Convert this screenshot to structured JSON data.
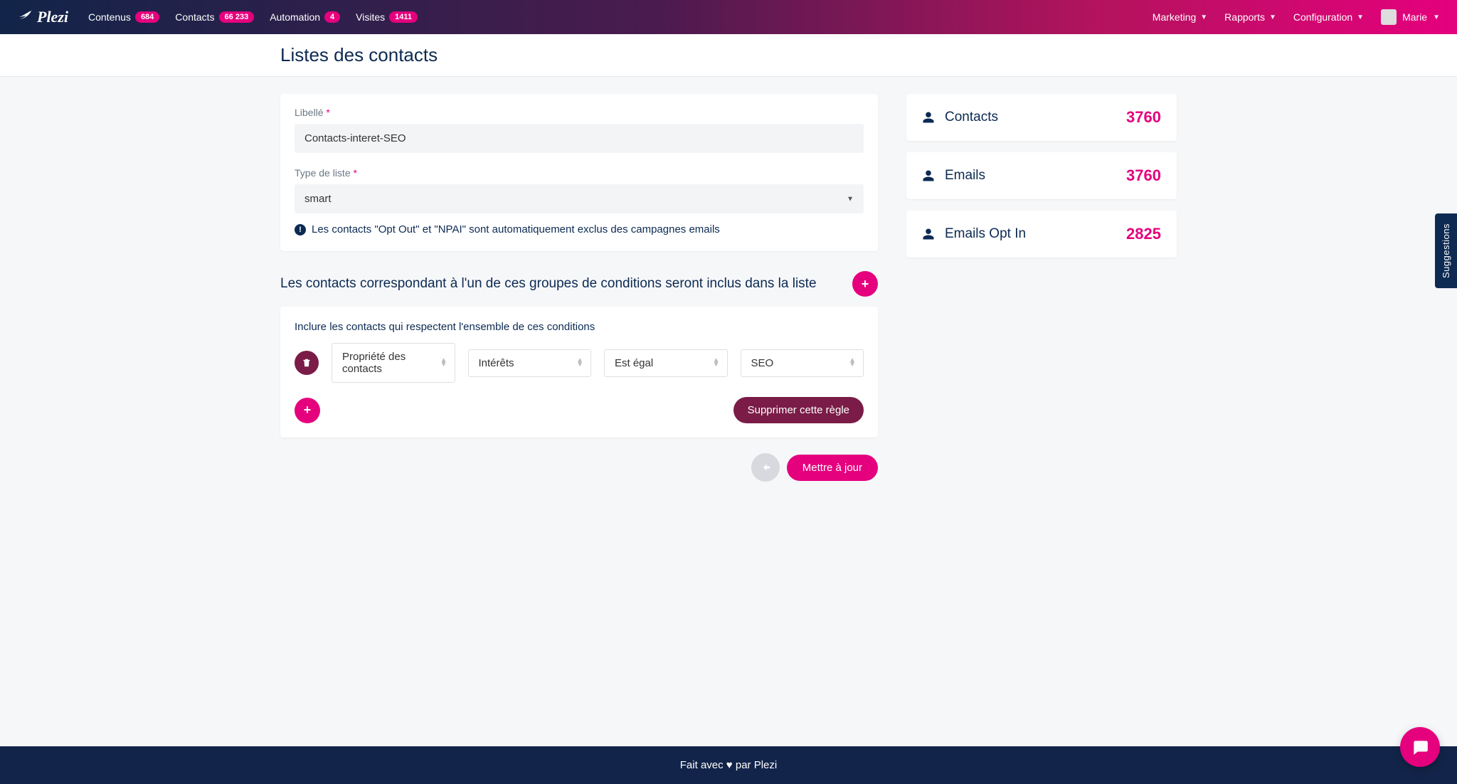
{
  "brand": "Plezi",
  "nav": {
    "left": [
      {
        "label": "Contenus",
        "badge": "684"
      },
      {
        "label": "Contacts",
        "badge": "66 233"
      },
      {
        "label": "Automation",
        "badge": "4"
      },
      {
        "label": "Visites",
        "badge": "1411"
      }
    ],
    "right": [
      {
        "label": "Marketing"
      },
      {
        "label": "Rapports"
      },
      {
        "label": "Configuration"
      }
    ],
    "user": "Marie"
  },
  "page": {
    "title": "Listes des contacts"
  },
  "form": {
    "libelle_label": "Libellé",
    "libelle_value": "Contacts-interet-SEO",
    "type_label": "Type de liste",
    "type_value": "smart",
    "info_text": "Les contacts \"Opt Out\" et \"NPAI\" sont automatiquement exclus des campagnes emails"
  },
  "conditions": {
    "heading": "Les contacts correspondant à l'un de ces groupes de conditions seront inclus dans la liste",
    "rule_intro": "Inclure les contacts qui respectent l'ensemble de ces conditions",
    "fields": {
      "property": "Propriété des contacts",
      "attribute": "Intérêts",
      "operator": "Est égal",
      "value": "SEO"
    },
    "delete_rule": "Supprimer cette règle"
  },
  "stats": [
    {
      "label": "Contacts",
      "value": "3760"
    },
    {
      "label": "Emails",
      "value": "3760"
    },
    {
      "label": "Emails Opt In",
      "value": "2825"
    }
  ],
  "actions": {
    "update": "Mettre à jour"
  },
  "footer": {
    "prefix": "Fait avec ",
    "suffix": " par Plezi"
  },
  "suggestions_tab": "Suggestions"
}
